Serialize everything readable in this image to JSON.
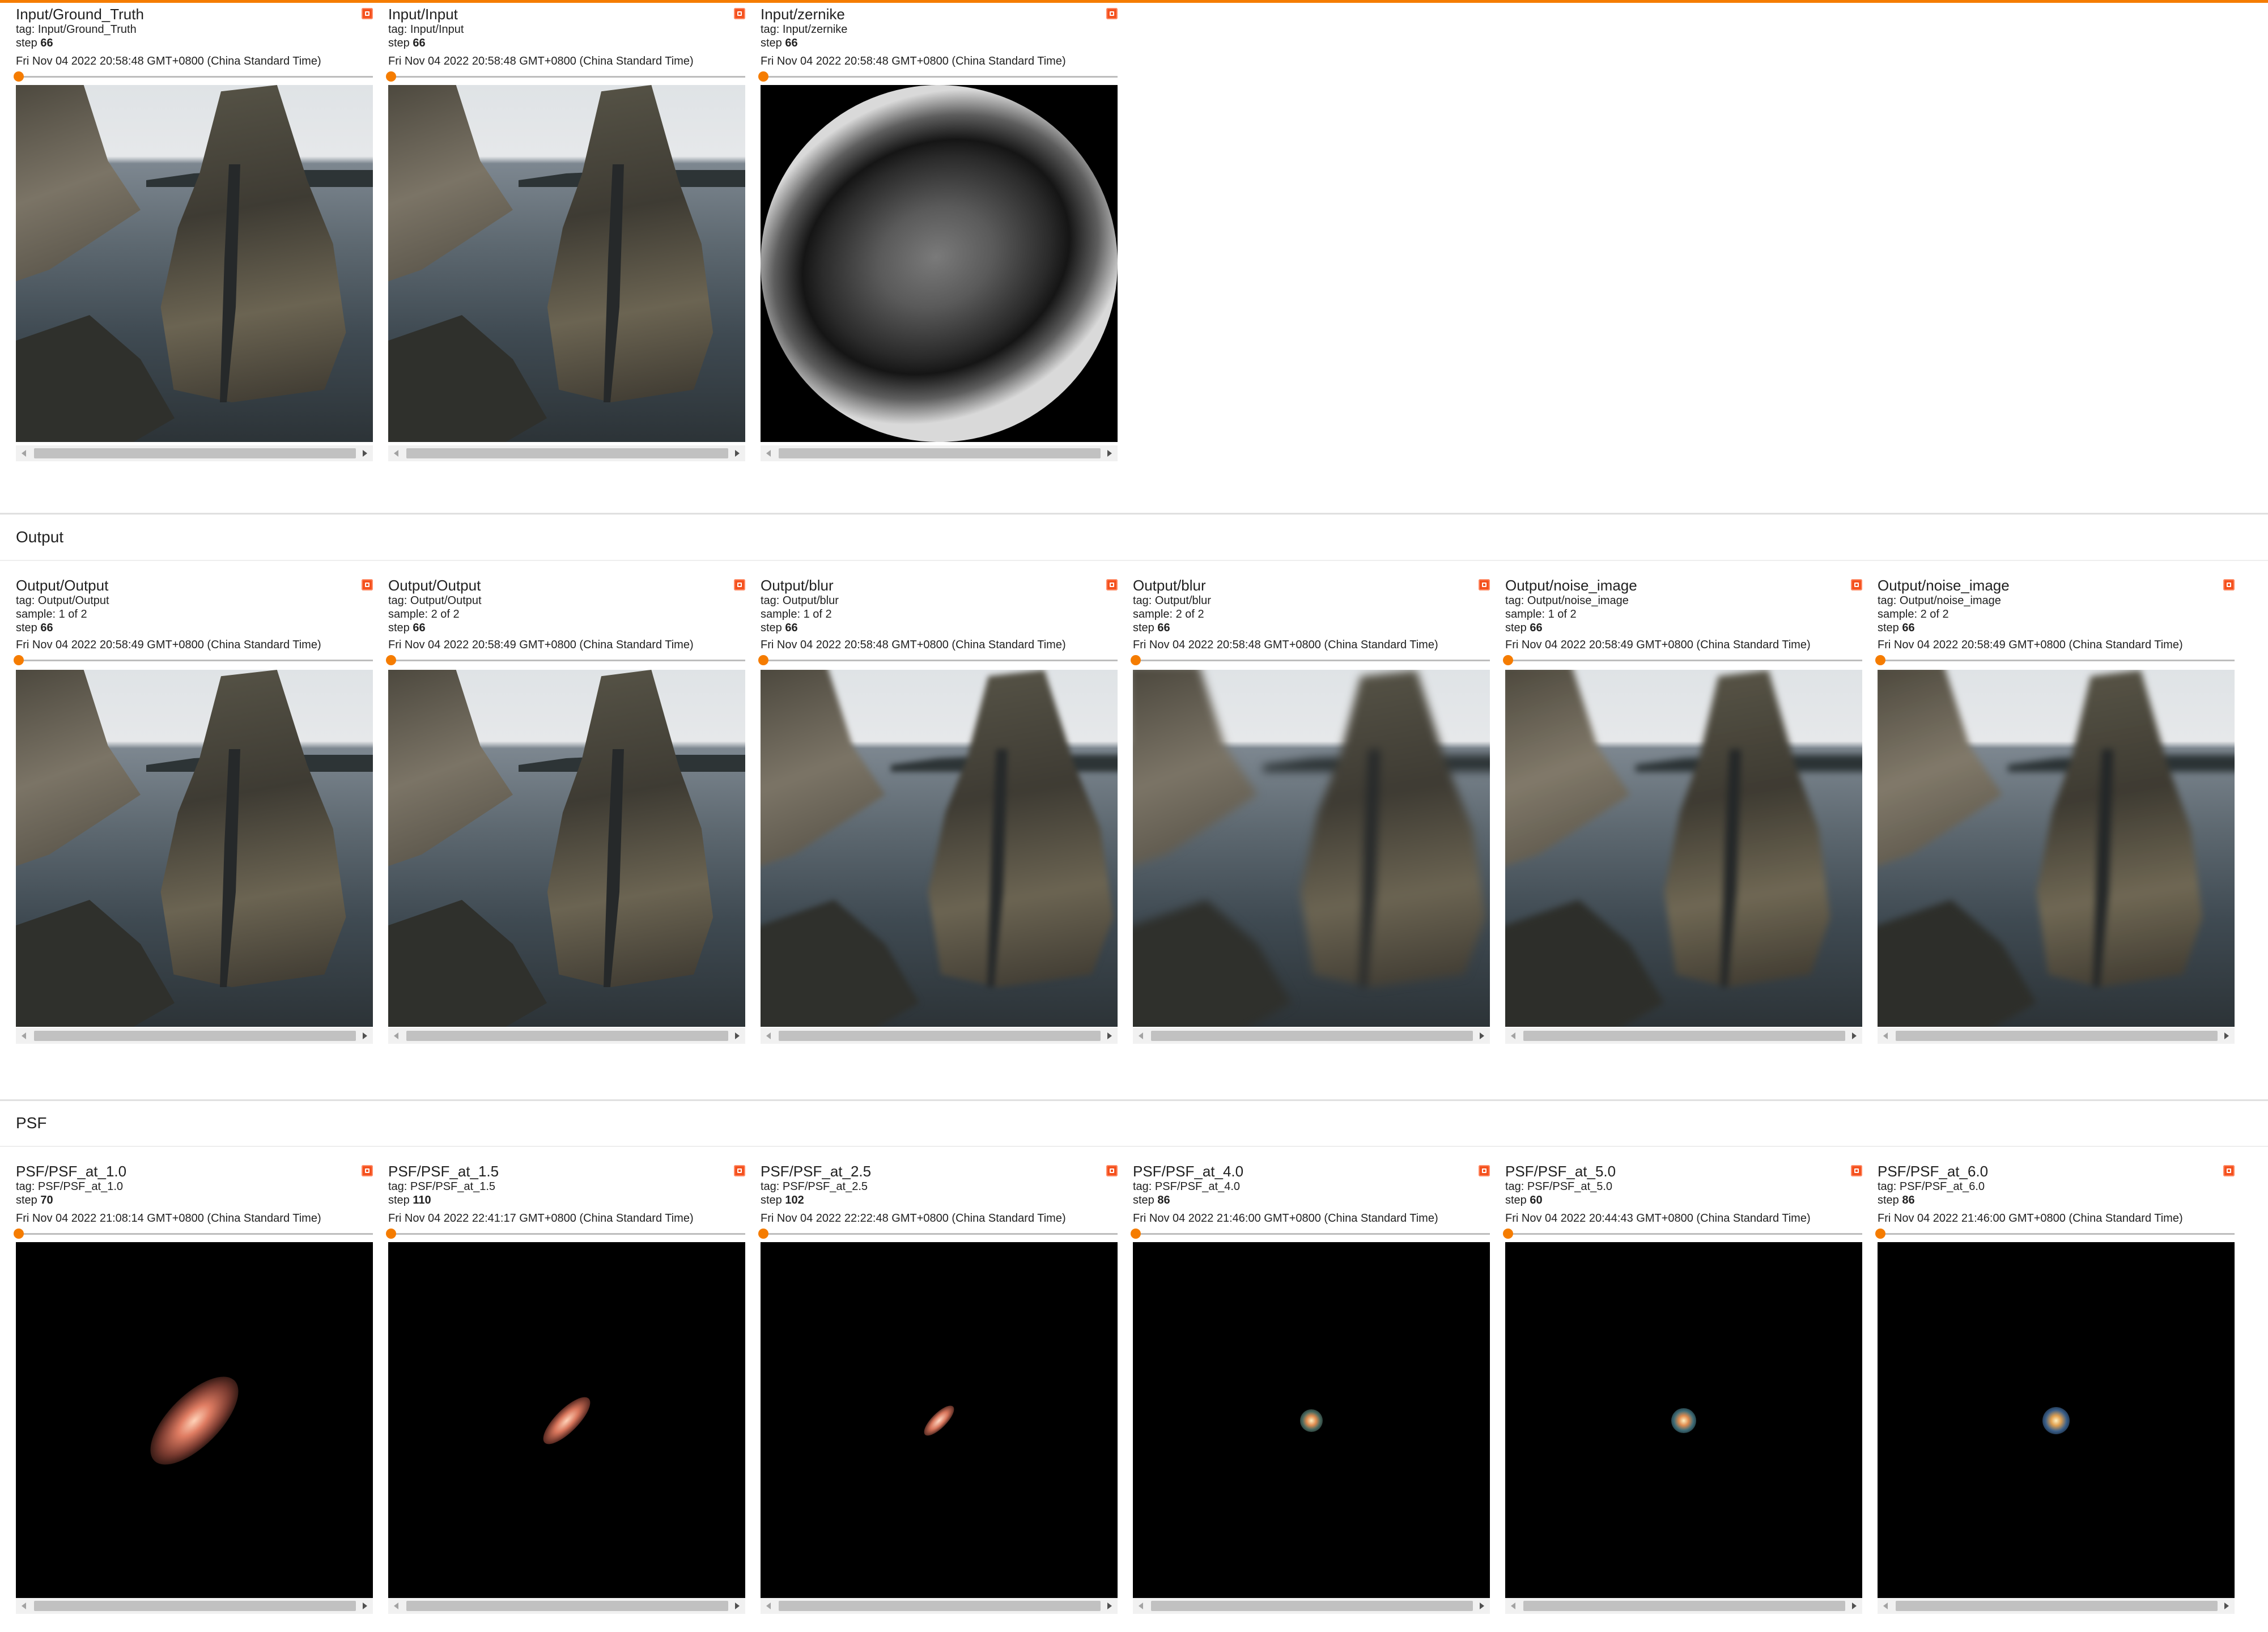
{
  "sections": {
    "input": {
      "cards": [
        {
          "title": "Input/Ground_Truth",
          "tag": "tag: Input/Ground_Truth",
          "step_label": "step",
          "step": "66",
          "timestamp": "Fri Nov 04 2022 20:58:48 GMT+0800 (China Standard Time)"
        },
        {
          "title": "Input/Input",
          "tag": "tag: Input/Input",
          "step_label": "step",
          "step": "66",
          "timestamp": "Fri Nov 04 2022 20:58:48 GMT+0800 (China Standard Time)"
        },
        {
          "title": "Input/zernike",
          "tag": "tag: Input/zernike",
          "step_label": "step",
          "step": "66",
          "timestamp": "Fri Nov 04 2022 20:58:48 GMT+0800 (China Standard Time)"
        }
      ]
    },
    "output": {
      "title": "Output",
      "cards": [
        {
          "title": "Output/Output",
          "tag": "tag: Output/Output",
          "sample": "sample: 1 of 2",
          "step_label": "step",
          "step": "66",
          "timestamp": "Fri Nov 04 2022 20:58:49 GMT+0800 (China Standard Time)"
        },
        {
          "title": "Output/Output",
          "tag": "tag: Output/Output",
          "sample": "sample: 2 of 2",
          "step_label": "step",
          "step": "66",
          "timestamp": "Fri Nov 04 2022 20:58:49 GMT+0800 (China Standard Time)"
        },
        {
          "title": "Output/blur",
          "tag": "tag: Output/blur",
          "sample": "sample: 1 of 2",
          "step_label": "step",
          "step": "66",
          "timestamp": "Fri Nov 04 2022 20:58:48 GMT+0800 (China Standard Time)"
        },
        {
          "title": "Output/blur",
          "tag": "tag: Output/blur",
          "sample": "sample: 2 of 2",
          "step_label": "step",
          "step": "66",
          "timestamp": "Fri Nov 04 2022 20:58:48 GMT+0800 (China Standard Time)"
        },
        {
          "title": "Output/noise_image",
          "tag": "tag: Output/noise_image",
          "sample": "sample: 1 of 2",
          "step_label": "step",
          "step": "66",
          "timestamp": "Fri Nov 04 2022 20:58:49 GMT+0800 (China Standard Time)"
        },
        {
          "title": "Output/noise_image",
          "tag": "tag: Output/noise_image",
          "sample": "sample: 2 of 2",
          "step_label": "step",
          "step": "66",
          "timestamp": "Fri Nov 04 2022 20:58:49 GMT+0800 (China Standard Time)"
        }
      ]
    },
    "psf": {
      "title": "PSF",
      "cards": [
        {
          "title": "PSF/PSF_at_1.0",
          "tag": "tag: PSF/PSF_at_1.0",
          "step_label": "step",
          "step": "70",
          "timestamp": "Fri Nov 04 2022 21:08:14 GMT+0800 (China Standard Time)"
        },
        {
          "title": "PSF/PSF_at_1.5",
          "tag": "tag: PSF/PSF_at_1.5",
          "step_label": "step",
          "step": "110",
          "timestamp": "Fri Nov 04 2022 22:41:17 GMT+0800 (China Standard Time)"
        },
        {
          "title": "PSF/PSF_at_2.5",
          "tag": "tag: PSF/PSF_at_2.5",
          "step_label": "step",
          "step": "102",
          "timestamp": "Fri Nov 04 2022 22:22:48 GMT+0800 (China Standard Time)"
        },
        {
          "title": "PSF/PSF_at_4.0",
          "tag": "tag: PSF/PSF_at_4.0",
          "step_label": "step",
          "step": "86",
          "timestamp": "Fri Nov 04 2022 21:46:00 GMT+0800 (China Standard Time)"
        },
        {
          "title": "PSF/PSF_at_5.0",
          "tag": "tag: PSF/PSF_at_5.0",
          "step_label": "step",
          "step": "60",
          "timestamp": "Fri Nov 04 2022 20:44:43 GMT+0800 (China Standard Time)"
        },
        {
          "title": "PSF/PSF_at_6.0",
          "tag": "tag: PSF/PSF_at_6.0",
          "step_label": "step",
          "step": "86",
          "timestamp": "Fri Nov 04 2022 21:46:00 GMT+0800 (China Standard Time)"
        }
      ]
    }
  },
  "colors": {
    "accent": "#f57c00",
    "close": "#f4511e"
  },
  "icons": {
    "card_action": "expand-icon",
    "scroll_left": "arrow-left-icon",
    "scroll_right": "arrow-right-icon"
  }
}
